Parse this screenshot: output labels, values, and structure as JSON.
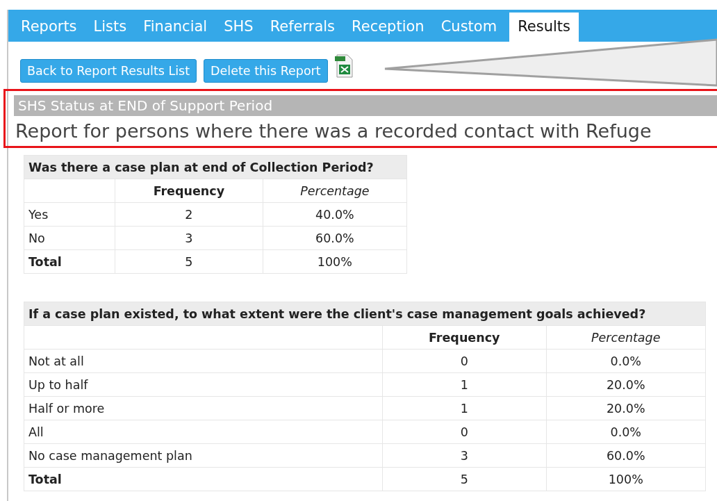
{
  "tabs": [
    {
      "label": "Reports",
      "selected": false
    },
    {
      "label": "Lists",
      "selected": false
    },
    {
      "label": "Financial",
      "selected": false
    },
    {
      "label": "SHS",
      "selected": false
    },
    {
      "label": "Referrals",
      "selected": false
    },
    {
      "label": "Reception",
      "selected": false
    },
    {
      "label": "Custom",
      "selected": false
    },
    {
      "label": "Results",
      "selected": true
    }
  ],
  "buttons": [
    "Back to Report Results List",
    "Delete this Report"
  ],
  "report": {
    "title": "SHS Status at END of Support Period",
    "subtitle": "Report for persons where there was a recorded contact with Refuge"
  },
  "tables": [
    {
      "title": "Was there a case plan at end of Collection Period?",
      "columns": [
        "Frequency",
        "Percentage"
      ],
      "rows": [
        {
          "kind": "item",
          "label": "Yes",
          "frequency": "2",
          "percentage": "40.0%"
        },
        {
          "kind": "item",
          "label": "No",
          "frequency": "3",
          "percentage": "60.0%"
        },
        {
          "kind": "total",
          "label": "Total",
          "frequency": "5",
          "percentage": "100%"
        }
      ]
    },
    {
      "title": "If a case plan existed, to what extent were the client's case management goals achieved?",
      "columns": [
        "Frequency",
        "Percentage"
      ],
      "rows": [
        {
          "kind": "item",
          "label": "Not at all",
          "frequency": "0",
          "percentage": "0.0%"
        },
        {
          "kind": "item",
          "label": "Up to half",
          "frequency": "1",
          "percentage": "20.0%"
        },
        {
          "kind": "item",
          "label": "Half or more",
          "frequency": "1",
          "percentage": "20.0%"
        },
        {
          "kind": "item",
          "label": "All",
          "frequency": "0",
          "percentage": "0.0%"
        },
        {
          "kind": "item",
          "label": "No case management plan",
          "frequency": "3",
          "percentage": "60.0%"
        },
        {
          "kind": "total",
          "label": "Total",
          "frequency": "5",
          "percentage": "100%"
        }
      ]
    }
  ]
}
